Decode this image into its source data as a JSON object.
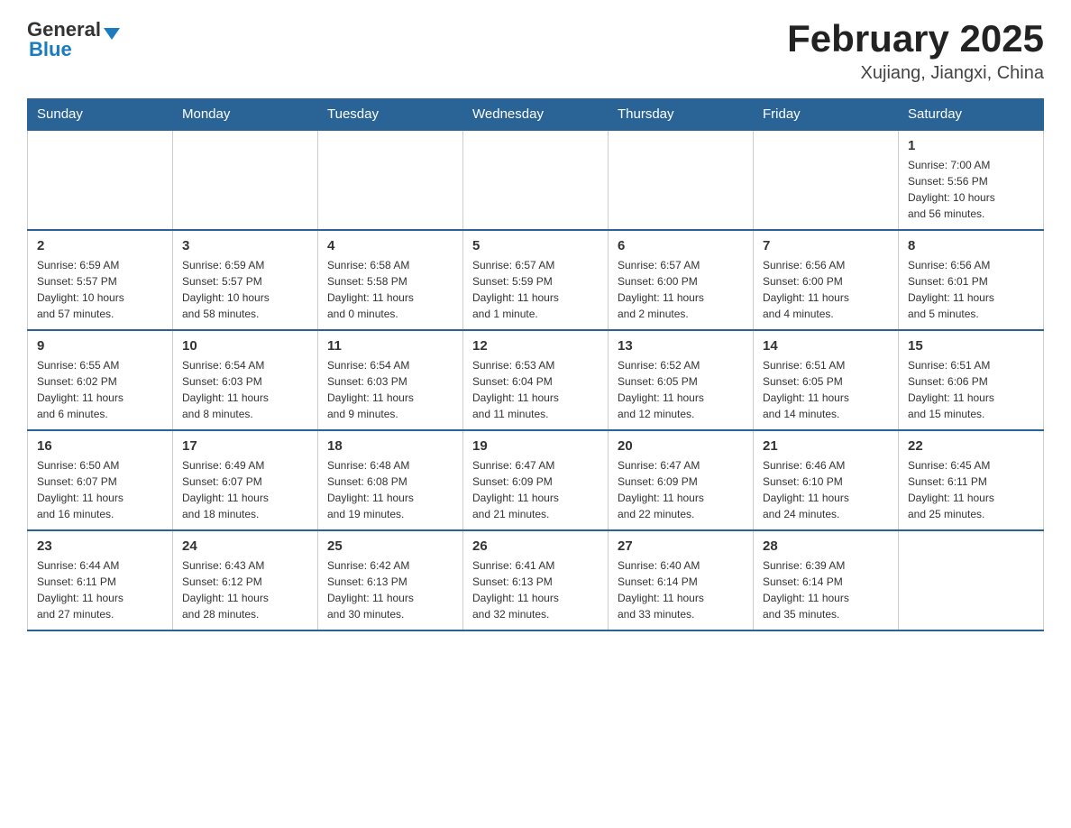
{
  "header": {
    "logo_general": "General",
    "logo_blue": "Blue",
    "month_title": "February 2025",
    "location": "Xujiang, Jiangxi, China"
  },
  "weekdays": [
    "Sunday",
    "Monday",
    "Tuesday",
    "Wednesday",
    "Thursday",
    "Friday",
    "Saturday"
  ],
  "weeks": [
    [
      {
        "day": "",
        "info": ""
      },
      {
        "day": "",
        "info": ""
      },
      {
        "day": "",
        "info": ""
      },
      {
        "day": "",
        "info": ""
      },
      {
        "day": "",
        "info": ""
      },
      {
        "day": "",
        "info": ""
      },
      {
        "day": "1",
        "info": "Sunrise: 7:00 AM\nSunset: 5:56 PM\nDaylight: 10 hours\nand 56 minutes."
      }
    ],
    [
      {
        "day": "2",
        "info": "Sunrise: 6:59 AM\nSunset: 5:57 PM\nDaylight: 10 hours\nand 57 minutes."
      },
      {
        "day": "3",
        "info": "Sunrise: 6:59 AM\nSunset: 5:57 PM\nDaylight: 10 hours\nand 58 minutes."
      },
      {
        "day": "4",
        "info": "Sunrise: 6:58 AM\nSunset: 5:58 PM\nDaylight: 11 hours\nand 0 minutes."
      },
      {
        "day": "5",
        "info": "Sunrise: 6:57 AM\nSunset: 5:59 PM\nDaylight: 11 hours\nand 1 minute."
      },
      {
        "day": "6",
        "info": "Sunrise: 6:57 AM\nSunset: 6:00 PM\nDaylight: 11 hours\nand 2 minutes."
      },
      {
        "day": "7",
        "info": "Sunrise: 6:56 AM\nSunset: 6:00 PM\nDaylight: 11 hours\nand 4 minutes."
      },
      {
        "day": "8",
        "info": "Sunrise: 6:56 AM\nSunset: 6:01 PM\nDaylight: 11 hours\nand 5 minutes."
      }
    ],
    [
      {
        "day": "9",
        "info": "Sunrise: 6:55 AM\nSunset: 6:02 PM\nDaylight: 11 hours\nand 6 minutes."
      },
      {
        "day": "10",
        "info": "Sunrise: 6:54 AM\nSunset: 6:03 PM\nDaylight: 11 hours\nand 8 minutes."
      },
      {
        "day": "11",
        "info": "Sunrise: 6:54 AM\nSunset: 6:03 PM\nDaylight: 11 hours\nand 9 minutes."
      },
      {
        "day": "12",
        "info": "Sunrise: 6:53 AM\nSunset: 6:04 PM\nDaylight: 11 hours\nand 11 minutes."
      },
      {
        "day": "13",
        "info": "Sunrise: 6:52 AM\nSunset: 6:05 PM\nDaylight: 11 hours\nand 12 minutes."
      },
      {
        "day": "14",
        "info": "Sunrise: 6:51 AM\nSunset: 6:05 PM\nDaylight: 11 hours\nand 14 minutes."
      },
      {
        "day": "15",
        "info": "Sunrise: 6:51 AM\nSunset: 6:06 PM\nDaylight: 11 hours\nand 15 minutes."
      }
    ],
    [
      {
        "day": "16",
        "info": "Sunrise: 6:50 AM\nSunset: 6:07 PM\nDaylight: 11 hours\nand 16 minutes."
      },
      {
        "day": "17",
        "info": "Sunrise: 6:49 AM\nSunset: 6:07 PM\nDaylight: 11 hours\nand 18 minutes."
      },
      {
        "day": "18",
        "info": "Sunrise: 6:48 AM\nSunset: 6:08 PM\nDaylight: 11 hours\nand 19 minutes."
      },
      {
        "day": "19",
        "info": "Sunrise: 6:47 AM\nSunset: 6:09 PM\nDaylight: 11 hours\nand 21 minutes."
      },
      {
        "day": "20",
        "info": "Sunrise: 6:47 AM\nSunset: 6:09 PM\nDaylight: 11 hours\nand 22 minutes."
      },
      {
        "day": "21",
        "info": "Sunrise: 6:46 AM\nSunset: 6:10 PM\nDaylight: 11 hours\nand 24 minutes."
      },
      {
        "day": "22",
        "info": "Sunrise: 6:45 AM\nSunset: 6:11 PM\nDaylight: 11 hours\nand 25 minutes."
      }
    ],
    [
      {
        "day": "23",
        "info": "Sunrise: 6:44 AM\nSunset: 6:11 PM\nDaylight: 11 hours\nand 27 minutes."
      },
      {
        "day": "24",
        "info": "Sunrise: 6:43 AM\nSunset: 6:12 PM\nDaylight: 11 hours\nand 28 minutes."
      },
      {
        "day": "25",
        "info": "Sunrise: 6:42 AM\nSunset: 6:13 PM\nDaylight: 11 hours\nand 30 minutes."
      },
      {
        "day": "26",
        "info": "Sunrise: 6:41 AM\nSunset: 6:13 PM\nDaylight: 11 hours\nand 32 minutes."
      },
      {
        "day": "27",
        "info": "Sunrise: 6:40 AM\nSunset: 6:14 PM\nDaylight: 11 hours\nand 33 minutes."
      },
      {
        "day": "28",
        "info": "Sunrise: 6:39 AM\nSunset: 6:14 PM\nDaylight: 11 hours\nand 35 minutes."
      },
      {
        "day": "",
        "info": ""
      }
    ]
  ]
}
